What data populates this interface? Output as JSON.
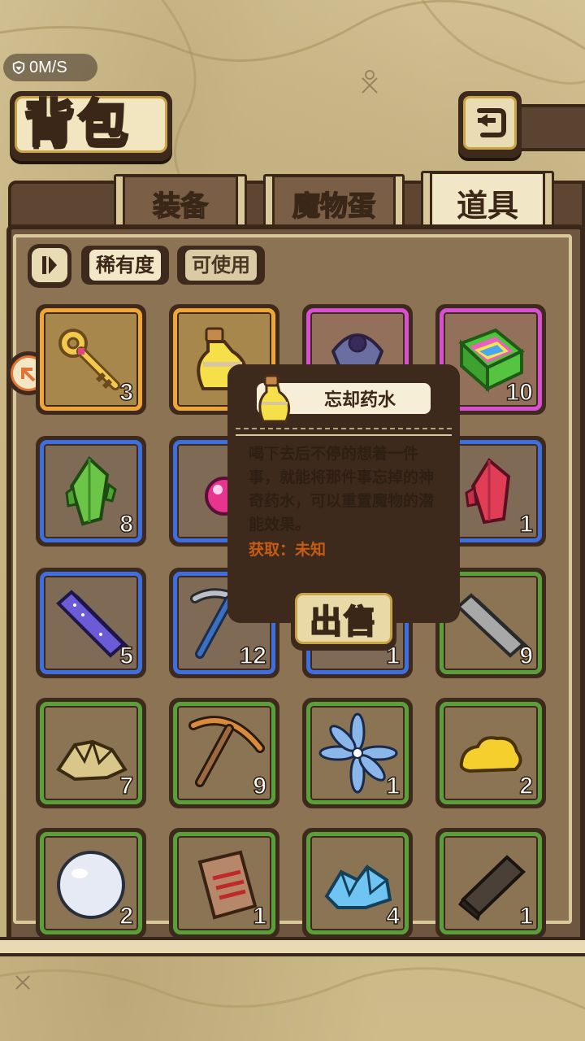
{
  "status": {
    "network_speed": "0M/S"
  },
  "header": {
    "title": "背包"
  },
  "tabs": [
    {
      "label": "装备",
      "active": false
    },
    {
      "label": "魔物蛋",
      "active": false
    },
    {
      "label": "道具",
      "active": true
    }
  ],
  "filters": [
    {
      "label": "稀有度",
      "active": true
    },
    {
      "label": "可使用",
      "active": false
    }
  ],
  "items": [
    {
      "name": "golden-key",
      "count": "3",
      "rarity": "orange"
    },
    {
      "name": "yellow-potion",
      "count": "",
      "rarity": "orange"
    },
    {
      "name": "purple-ornament",
      "count": "",
      "rarity": "purple"
    },
    {
      "name": "rainbow-block",
      "count": "10",
      "rarity": "purple"
    },
    {
      "name": "green-crystal",
      "count": "8",
      "rarity": "blue"
    },
    {
      "name": "pink-orb",
      "count": "",
      "rarity": "blue"
    },
    {
      "name": "hidden-item",
      "count": "",
      "rarity": "blue"
    },
    {
      "name": "red-crystal",
      "count": "1",
      "rarity": "blue"
    },
    {
      "name": "purple-ingot",
      "count": "5",
      "rarity": "blue"
    },
    {
      "name": "steel-pickaxe",
      "count": "12",
      "rarity": "blue"
    },
    {
      "name": "hidden-item-2",
      "count": "1",
      "rarity": "blue"
    },
    {
      "name": "iron-ingot",
      "count": "9",
      "rarity": "green"
    },
    {
      "name": "gold-ore",
      "count": "7",
      "rarity": "green"
    },
    {
      "name": "copper-pickaxe",
      "count": "9",
      "rarity": "green"
    },
    {
      "name": "blue-flower",
      "count": "1",
      "rarity": "green"
    },
    {
      "name": "gold-nugget",
      "count": "2",
      "rarity": "green"
    },
    {
      "name": "pearl",
      "count": "2",
      "rarity": "green"
    },
    {
      "name": "fish-tablet",
      "count": "1",
      "rarity": "green"
    },
    {
      "name": "ice-crystal",
      "count": "4",
      "rarity": "green"
    },
    {
      "name": "wood-plank",
      "count": "1",
      "rarity": "green"
    }
  ],
  "tooltip": {
    "name": "忘却药水",
    "description": "喝下去后不停的想着一件事，就能将那件事忘掉的神奇药水，可以重置魔物的潜能效果。",
    "source": "获取：未知",
    "sell_label": "出售"
  },
  "colors": {
    "orange": "#f0a635",
    "purple": "#d94fd1",
    "blue": "#3d6fe0",
    "green": "#5aa03a",
    "source_text": "#c65c13"
  }
}
